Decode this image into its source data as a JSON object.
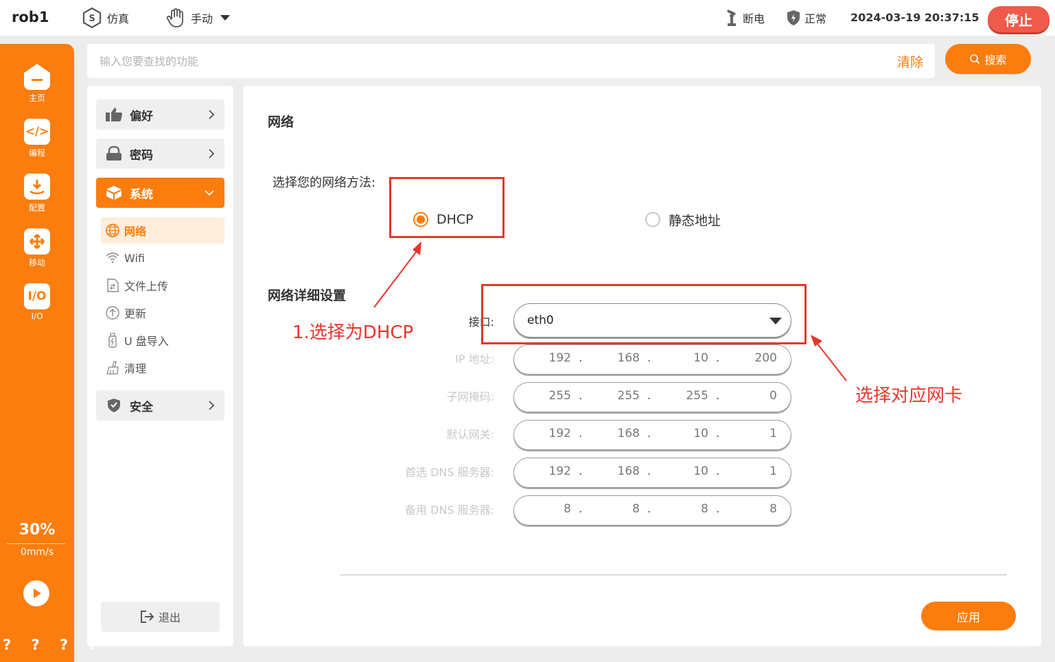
{
  "topbar": {
    "robot_name": "rob1",
    "mode": "仿真",
    "control": "手动",
    "power": "断电",
    "state": "正常",
    "datetime": "2024-03-19 20:37:15",
    "stop_label": "停止"
  },
  "leftnav": {
    "items": [
      {
        "label": "主页",
        "icon": "home-icon"
      },
      {
        "label": "编程",
        "icon": "code-icon"
      },
      {
        "label": "配置",
        "icon": "config-icon"
      },
      {
        "label": "移动",
        "icon": "move-icon"
      },
      {
        "label": "I/O",
        "icon": "io-icon"
      }
    ],
    "io_glyph": "I/O",
    "speed_percent": "30%",
    "speed_value": "0mm/s",
    "bottom_marks": "? ? ? ?"
  },
  "search": {
    "placeholder": "输入您要查找的功能",
    "value": "",
    "clear_label": "清除",
    "button_label": "搜索"
  },
  "sidebar": {
    "preference": "偏好",
    "password": "密码",
    "system": "系统",
    "security": "安全",
    "system_items": [
      {
        "label": "网络",
        "icon": "globe-icon"
      },
      {
        "label": "Wifi",
        "icon": "wifi-icon"
      },
      {
        "label": "文件上传",
        "icon": "file-upload-icon"
      },
      {
        "label": "更新",
        "icon": "update-icon"
      },
      {
        "label": "U 盘导入",
        "icon": "usb-icon"
      },
      {
        "label": "清理",
        "icon": "clean-icon"
      }
    ],
    "logout": "退出"
  },
  "main": {
    "title": "网络",
    "method_label": "选择您的网络方法:",
    "dhcp_label": "DHCP",
    "static_label": "静态地址",
    "selected_method": "DHCP",
    "detail_title": "网络详细设置",
    "interface_label": "接口:",
    "interface_value": "eth0",
    "fields": [
      {
        "label": "IP 地址:",
        "octets": [
          "192",
          "168",
          "10",
          "200"
        ]
      },
      {
        "label": "子网掩码:",
        "octets": [
          "255",
          "255",
          "255",
          "0"
        ]
      },
      {
        "label": "默认网关:",
        "octets": [
          "192",
          "168",
          "10",
          "1"
        ]
      },
      {
        "label": "首选 DNS 服务器:",
        "octets": [
          "192",
          "168",
          "10",
          "1"
        ]
      },
      {
        "label": "备用 DNS 服务器:",
        "octets": [
          "8",
          "8",
          "8",
          "8"
        ]
      }
    ],
    "apply_label": "应用"
  },
  "annotations": {
    "dhcp_note": "1.选择为DHCP",
    "nic_note": "选择对应网卡",
    "color": "#e8352b"
  },
  "colors": {
    "accent": "#fb7d0e",
    "stop": "#f05a4a"
  }
}
